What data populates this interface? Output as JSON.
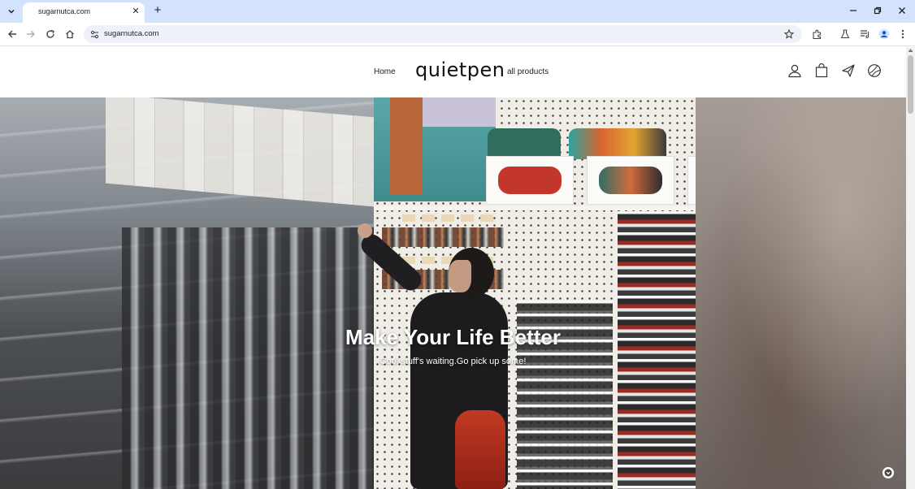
{
  "browser": {
    "tab_title": "sugarnutca.com",
    "url": "sugarnutca.com",
    "icons": [
      "tab-search-icon",
      "close-icon",
      "plus-icon",
      "minimize-icon",
      "restore-icon",
      "close-window-icon",
      "back-icon",
      "forward-icon",
      "reload-icon",
      "home-icon",
      "site-settings-icon",
      "star-icon",
      "extensions-icon",
      "lab-icon",
      "media-icon",
      "profile-icon",
      "menu-icon"
    ]
  },
  "site": {
    "logo": "quietpen",
    "nav": {
      "home": "Home",
      "all_products": "all products"
    },
    "header_icons": [
      "account-icon",
      "cart-icon",
      "plane-icon",
      "globe-icon"
    ]
  },
  "hero": {
    "title": "Make Your Life Better",
    "subtitle": "Cool stuff's waiting.Go pick up some!"
  },
  "colors": {
    "tabstrip": "#d3e3fd",
    "omnibox": "#eef1f7",
    "text": "#1f1f1f",
    "hero_text": "#ffffff"
  }
}
